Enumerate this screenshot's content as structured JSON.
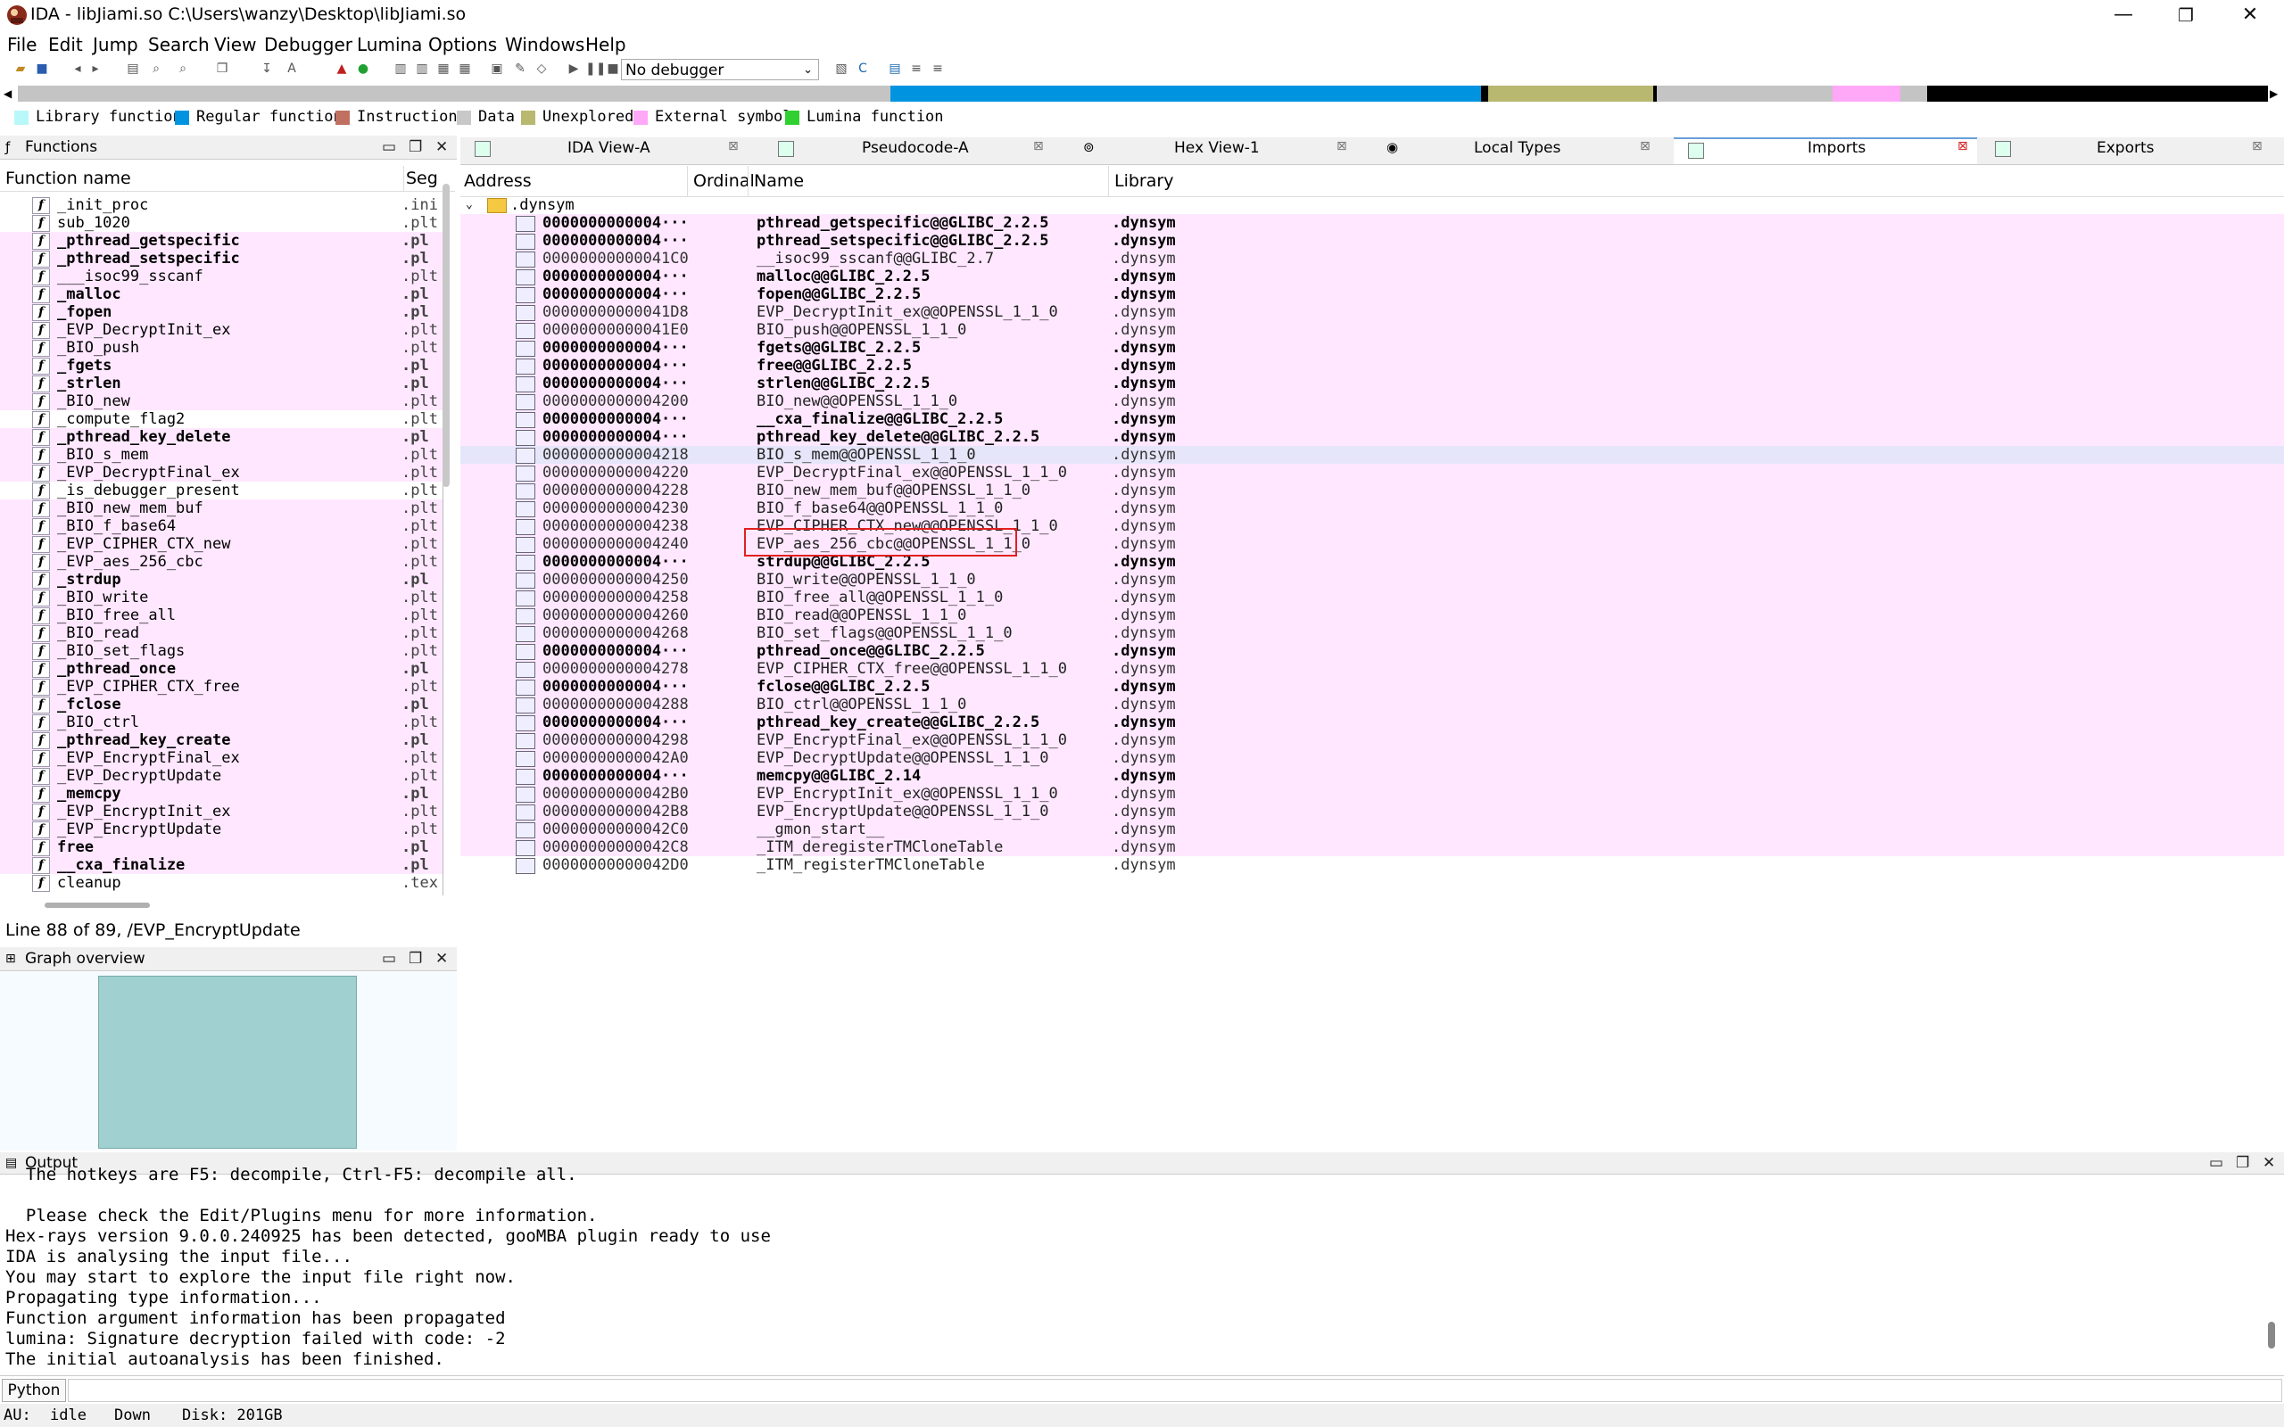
{
  "window": {
    "title": "IDA - libJiami.so C:\\Users\\wanzy\\Desktop\\libJiami.so",
    "minimize": "—",
    "maximize": "❐",
    "close": "✕"
  },
  "menu": [
    "File",
    "Edit",
    "Jump",
    "Search",
    "View",
    "Debugger",
    "Lumina",
    "Options",
    "Windows",
    "Help"
  ],
  "toolbar": {
    "debugger_select": "No debugger"
  },
  "legend": [
    {
      "label": "Library function",
      "color": "#b8f8f8"
    },
    {
      "label": "Regular function",
      "color": "#0094e0"
    },
    {
      "label": "Instruction",
      "color": "#c07060"
    },
    {
      "label": "Data",
      "color": "#c8c8c8"
    },
    {
      "label": "Unexplored",
      "color": "#b8b870"
    },
    {
      "label": "External symbol",
      "color": "#ffa8f8"
    },
    {
      "label": "Lumina function",
      "color": "#30d030"
    }
  ],
  "functions_panel": {
    "title": "Functions",
    "col_name": "Function name",
    "col_seg": "Seg",
    "rows": [
      {
        "name": "_init_proc",
        "seg": ".ini",
        "bold": false,
        "pink": false
      },
      {
        "name": "sub_1020",
        "seg": ".plt",
        "bold": false,
        "pink": false
      },
      {
        "name": "_pthread_getspecific",
        "seg": ".pl",
        "bold": true,
        "pink": true
      },
      {
        "name": "_pthread_setspecific",
        "seg": ".pl",
        "bold": true,
        "pink": true
      },
      {
        "name": "___isoc99_sscanf",
        "seg": ".plt",
        "bold": false,
        "pink": true
      },
      {
        "name": "_malloc",
        "seg": ".pl",
        "bold": true,
        "pink": true
      },
      {
        "name": "_fopen",
        "seg": ".pl",
        "bold": true,
        "pink": true
      },
      {
        "name": "_EVP_DecryptInit_ex",
        "seg": ".plt",
        "bold": false,
        "pink": true
      },
      {
        "name": "_BIO_push",
        "seg": ".plt",
        "bold": false,
        "pink": true
      },
      {
        "name": "_fgets",
        "seg": ".pl",
        "bold": true,
        "pink": true
      },
      {
        "name": "_strlen",
        "seg": ".pl",
        "bold": true,
        "pink": true
      },
      {
        "name": "_BIO_new",
        "seg": ".plt",
        "bold": false,
        "pink": true
      },
      {
        "name": "_compute_flag2",
        "seg": ".plt",
        "bold": false,
        "pink": false
      },
      {
        "name": "_pthread_key_delete",
        "seg": ".pl",
        "bold": true,
        "pink": true
      },
      {
        "name": "_BIO_s_mem",
        "seg": ".plt",
        "bold": false,
        "pink": true
      },
      {
        "name": "_EVP_DecryptFinal_ex",
        "seg": ".plt",
        "bold": false,
        "pink": true
      },
      {
        "name": "_is_debugger_present",
        "seg": ".plt",
        "bold": false,
        "pink": false
      },
      {
        "name": "_BIO_new_mem_buf",
        "seg": ".plt",
        "bold": false,
        "pink": true
      },
      {
        "name": "_BIO_f_base64",
        "seg": ".plt",
        "bold": false,
        "pink": true
      },
      {
        "name": "_EVP_CIPHER_CTX_new",
        "seg": ".plt",
        "bold": false,
        "pink": true
      },
      {
        "name": "_EVP_aes_256_cbc",
        "seg": ".plt",
        "bold": false,
        "pink": true
      },
      {
        "name": "_strdup",
        "seg": ".pl",
        "bold": true,
        "pink": true
      },
      {
        "name": "_BIO_write",
        "seg": ".plt",
        "bold": false,
        "pink": true
      },
      {
        "name": "_BIO_free_all",
        "seg": ".plt",
        "bold": false,
        "pink": true
      },
      {
        "name": "_BIO_read",
        "seg": ".plt",
        "bold": false,
        "pink": true
      },
      {
        "name": "_BIO_set_flags",
        "seg": ".plt",
        "bold": false,
        "pink": true
      },
      {
        "name": "_pthread_once",
        "seg": ".pl",
        "bold": true,
        "pink": true
      },
      {
        "name": "_EVP_CIPHER_CTX_free",
        "seg": ".plt",
        "bold": false,
        "pink": true
      },
      {
        "name": "_fclose",
        "seg": ".pl",
        "bold": true,
        "pink": true
      },
      {
        "name": "_BIO_ctrl",
        "seg": ".plt",
        "bold": false,
        "pink": true
      },
      {
        "name": "_pthread_key_create",
        "seg": ".pl",
        "bold": true,
        "pink": true
      },
      {
        "name": "_EVP_EncryptFinal_ex",
        "seg": ".plt",
        "bold": false,
        "pink": true
      },
      {
        "name": "_EVP_DecryptUpdate",
        "seg": ".plt",
        "bold": false,
        "pink": true
      },
      {
        "name": "_memcpy",
        "seg": ".pl",
        "bold": true,
        "pink": true
      },
      {
        "name": "_EVP_EncryptInit_ex",
        "seg": ".plt",
        "bold": false,
        "pink": true
      },
      {
        "name": "_EVP_EncryptUpdate",
        "seg": ".plt",
        "bold": false,
        "pink": true
      },
      {
        "name": "free",
        "seg": ".pl",
        "bold": true,
        "pink": true
      },
      {
        "name": "__cxa_finalize",
        "seg": ".pl",
        "bold": true,
        "pink": true
      },
      {
        "name": "cleanup",
        "seg": ".tex",
        "bold": false,
        "pink": false
      }
    ],
    "status": "Line 88 of 89, /EVP_EncryptUpdate"
  },
  "graph_overview": {
    "title": "Graph overview"
  },
  "tabs": [
    {
      "label": "IDA View-A"
    },
    {
      "label": "Pseudocode-A"
    },
    {
      "label": "Hex View-1"
    },
    {
      "label": "Local Types"
    },
    {
      "label": "Imports"
    },
    {
      "label": "Exports"
    }
  ],
  "imports": {
    "col_address": "Address",
    "col_ordinal": "Ordinal",
    "col_name": "Name",
    "col_library": "Library",
    "group": ".dynsym",
    "rows": [
      {
        "addr": "0000000000004···",
        "name": "pthread_getspecific@@GLIBC_2.2.5",
        "lib": ".dynsym",
        "bold": true,
        "pink": true
      },
      {
        "addr": "0000000000004···",
        "name": "pthread_setspecific@@GLIBC_2.2.5",
        "lib": ".dynsym",
        "bold": true,
        "pink": true
      },
      {
        "addr": "00000000000041C0",
        "name": "__isoc99_sscanf@@GLIBC_2.7",
        "lib": ".dynsym",
        "bold": false,
        "pink": true
      },
      {
        "addr": "0000000000004···",
        "name": "malloc@@GLIBC_2.2.5",
        "lib": ".dynsym",
        "bold": true,
        "pink": true
      },
      {
        "addr": "0000000000004···",
        "name": "fopen@@GLIBC_2.2.5",
        "lib": ".dynsym",
        "bold": true,
        "pink": true
      },
      {
        "addr": "00000000000041D8",
        "name": "EVP_DecryptInit_ex@@OPENSSL_1_1_0",
        "lib": ".dynsym",
        "bold": false,
        "pink": true
      },
      {
        "addr": "00000000000041E0",
        "name": "BIO_push@@OPENSSL_1_1_0",
        "lib": ".dynsym",
        "bold": false,
        "pink": true
      },
      {
        "addr": "0000000000004···",
        "name": "fgets@@GLIBC_2.2.5",
        "lib": ".dynsym",
        "bold": true,
        "pink": true
      },
      {
        "addr": "0000000000004···",
        "name": "free@@GLIBC_2.2.5",
        "lib": ".dynsym",
        "bold": true,
        "pink": true
      },
      {
        "addr": "0000000000004···",
        "name": "strlen@@GLIBC_2.2.5",
        "lib": ".dynsym",
        "bold": true,
        "pink": true
      },
      {
        "addr": "0000000000004200",
        "name": "BIO_new@@OPENSSL_1_1_0",
        "lib": ".dynsym",
        "bold": false,
        "pink": true
      },
      {
        "addr": "0000000000004···",
        "name": "__cxa_finalize@@GLIBC_2.2.5",
        "lib": ".dynsym",
        "bold": true,
        "pink": true
      },
      {
        "addr": "0000000000004···",
        "name": "pthread_key_delete@@GLIBC_2.2.5",
        "lib": ".dynsym",
        "bold": true,
        "pink": true
      },
      {
        "addr": "0000000000004218",
        "name": "BIO_s_mem@@OPENSSL_1_1_0",
        "lib": ".dynsym",
        "bold": false,
        "pink": false,
        "sel": true
      },
      {
        "addr": "0000000000004220",
        "name": "EVP_DecryptFinal_ex@@OPENSSL_1_1_0",
        "lib": ".dynsym",
        "bold": false,
        "pink": true
      },
      {
        "addr": "0000000000004228",
        "name": "BIO_new_mem_buf@@OPENSSL_1_1_0",
        "lib": ".dynsym",
        "bold": false,
        "pink": true
      },
      {
        "addr": "0000000000004230",
        "name": "BIO_f_base64@@OPENSSL_1_1_0",
        "lib": ".dynsym",
        "bold": false,
        "pink": true
      },
      {
        "addr": "0000000000004238",
        "name": "EVP_CIPHER_CTX_new@@OPENSSL_1_1_0",
        "lib": ".dynsym",
        "bold": false,
        "pink": true
      },
      {
        "addr": "0000000000004240",
        "name": "EVP_aes_256_cbc@@OPENSSL_1_1_0",
        "lib": ".dynsym",
        "bold": false,
        "pink": true,
        "highlight": true
      },
      {
        "addr": "0000000000004···",
        "name": "strdup@@GLIBC_2.2.5",
        "lib": ".dynsym",
        "bold": true,
        "pink": true
      },
      {
        "addr": "0000000000004250",
        "name": "BIO_write@@OPENSSL_1_1_0",
        "lib": ".dynsym",
        "bold": false,
        "pink": true
      },
      {
        "addr": "0000000000004258",
        "name": "BIO_free_all@@OPENSSL_1_1_0",
        "lib": ".dynsym",
        "bold": false,
        "pink": true
      },
      {
        "addr": "0000000000004260",
        "name": "BIO_read@@OPENSSL_1_1_0",
        "lib": ".dynsym",
        "bold": false,
        "pink": true
      },
      {
        "addr": "0000000000004268",
        "name": "BIO_set_flags@@OPENSSL_1_1_0",
        "lib": ".dynsym",
        "bold": false,
        "pink": true
      },
      {
        "addr": "0000000000004···",
        "name": "pthread_once@@GLIBC_2.2.5",
        "lib": ".dynsym",
        "bold": true,
        "pink": true
      },
      {
        "addr": "0000000000004278",
        "name": "EVP_CIPHER_CTX_free@@OPENSSL_1_1_0",
        "lib": ".dynsym",
        "bold": false,
        "pink": true
      },
      {
        "addr": "0000000000004···",
        "name": "fclose@@GLIBC_2.2.5",
        "lib": ".dynsym",
        "bold": true,
        "pink": true
      },
      {
        "addr": "0000000000004288",
        "name": "BIO_ctrl@@OPENSSL_1_1_0",
        "lib": ".dynsym",
        "bold": false,
        "pink": true
      },
      {
        "addr": "0000000000004···",
        "name": "pthread_key_create@@GLIBC_2.2.5",
        "lib": ".dynsym",
        "bold": true,
        "pink": true
      },
      {
        "addr": "0000000000004298",
        "name": "EVP_EncryptFinal_ex@@OPENSSL_1_1_0",
        "lib": ".dynsym",
        "bold": false,
        "pink": true
      },
      {
        "addr": "00000000000042A0",
        "name": "EVP_DecryptUpdate@@OPENSSL_1_1_0",
        "lib": ".dynsym",
        "bold": false,
        "pink": true
      },
      {
        "addr": "0000000000004···",
        "name": "memcpy@@GLIBC_2.14",
        "lib": ".dynsym",
        "bold": true,
        "pink": true
      },
      {
        "addr": "00000000000042B0",
        "name": "EVP_EncryptInit_ex@@OPENSSL_1_1_0",
        "lib": ".dynsym",
        "bold": false,
        "pink": true
      },
      {
        "addr": "00000000000042B8",
        "name": "EVP_EncryptUpdate@@OPENSSL_1_1_0",
        "lib": ".dynsym",
        "bold": false,
        "pink": true
      },
      {
        "addr": "00000000000042C0",
        "name": "__gmon_start__",
        "lib": ".dynsym",
        "bold": false,
        "pink": true
      },
      {
        "addr": "00000000000042C8",
        "name": "_ITM_deregisterTMCloneTable",
        "lib": ".dynsym",
        "bold": false,
        "pink": true
      },
      {
        "addr": "00000000000042D0",
        "name": "_ITM_registerTMCloneTable",
        "lib": ".dynsym",
        "bold": false,
        "pink": false
      }
    ]
  },
  "output": {
    "title": "Output",
    "lines": [
      "  The hotkeys are F5: decompile, Ctrl-F5: decompile all.",
      "",
      "  Please check the Edit/Plugins menu for more information.",
      "Hex-rays version 9.0.0.240925 has been detected, gooMBA plugin ready to use",
      "IDA is analysing the input file...",
      "You may start to explore the input file right now.",
      "Propagating type information...",
      "Function argument information has been propagated",
      "lumina: Signature decryption failed with code: -2",
      "The initial autoanalysis has been finished."
    ]
  },
  "python_button": "Python",
  "statusbar": {
    "au_label": "AU:",
    "au_state": "idle",
    "direction": "Down",
    "disk": "Disk: 201GB"
  }
}
